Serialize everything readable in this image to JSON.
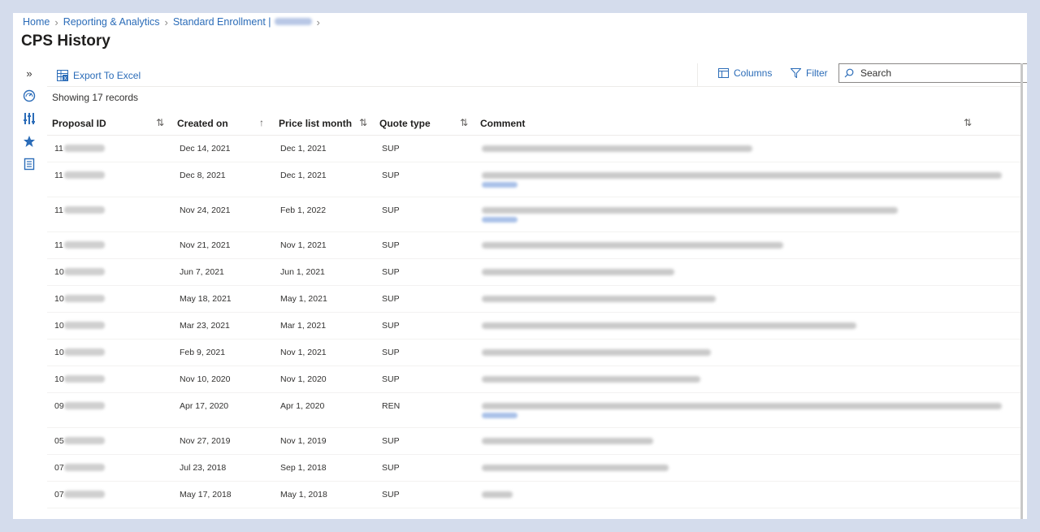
{
  "breadcrumb": {
    "items": [
      "Home",
      "Reporting & Analytics",
      "Standard Enrollment |"
    ]
  },
  "page": {
    "title": "CPS History"
  },
  "toolbar": {
    "export_label": "Export To Excel",
    "columns_label": "Columns",
    "filter_label": "Filter",
    "search_placeholder": "Search"
  },
  "records": {
    "count_text": "Showing 17 records"
  },
  "table": {
    "headers": [
      "Proposal ID",
      "Created on",
      "Price list month",
      "Quote type",
      "Comment"
    ],
    "rows": [
      {
        "pid": "11",
        "created": "Dec 14, 2021",
        "month": "Dec 1, 2021",
        "type": "SUP",
        "comment_lines": 1,
        "comment_len": 0.52
      },
      {
        "pid": "11",
        "created": "Dec 8, 2021",
        "month": "Dec 1, 2021",
        "type": "SUP",
        "comment_lines": 2,
        "comment_len": 1.0
      },
      {
        "pid": "11",
        "created": "Nov 24, 2021",
        "month": "Feb 1, 2022",
        "type": "SUP",
        "comment_lines": 2,
        "comment_len": 0.8
      },
      {
        "pid": "11",
        "created": "Nov 21, 2021",
        "month": "Nov 1, 2021",
        "type": "SUP",
        "comment_lines": 1,
        "comment_len": 0.58
      },
      {
        "pid": "10",
        "created": "Jun 7, 2021",
        "month": "Jun 1, 2021",
        "type": "SUP",
        "comment_lines": 1,
        "comment_len": 0.37
      },
      {
        "pid": "10",
        "created": "May 18, 2021",
        "month": "May 1, 2021",
        "type": "SUP",
        "comment_lines": 1,
        "comment_len": 0.45
      },
      {
        "pid": "10",
        "created": "Mar 23, 2021",
        "month": "Mar 1, 2021",
        "type": "SUP",
        "comment_lines": 1,
        "comment_len": 0.72
      },
      {
        "pid": "10",
        "created": "Feb 9, 2021",
        "month": "Nov 1, 2021",
        "type": "SUP",
        "comment_lines": 1,
        "comment_len": 0.44
      },
      {
        "pid": "10",
        "created": "Nov 10, 2020",
        "month": "Nov 1, 2020",
        "type": "SUP",
        "comment_lines": 1,
        "comment_len": 0.42
      },
      {
        "pid": "09",
        "created": "Apr 17, 2020",
        "month": "Apr 1, 2020",
        "type": "REN",
        "comment_lines": 2,
        "comment_len": 1.0
      },
      {
        "pid": "05",
        "created": "Nov 27, 2019",
        "month": "Nov 1, 2019",
        "type": "SUP",
        "comment_lines": 1,
        "comment_len": 0.33
      },
      {
        "pid": "07",
        "created": "Jul 23, 2018",
        "month": "Sep 1, 2018",
        "type": "SUP",
        "comment_lines": 1,
        "comment_len": 0.36
      },
      {
        "pid": "07",
        "created": "May 17, 2018",
        "month": "May 1, 2018",
        "type": "SUP",
        "comment_lines": 1,
        "comment_len": 0.06
      }
    ]
  },
  "colors": {
    "link": "#2b6cb8",
    "backdrop": "#d4dcec"
  },
  "icons": {
    "rail": [
      "expand-chevrons-icon",
      "dashboard-gauge-icon",
      "reports-icon",
      "favorites-star-icon",
      "book-icon"
    ],
    "toolbar": [
      "excel-icon",
      "columns-icon",
      "filter-icon",
      "search-icon"
    ]
  }
}
